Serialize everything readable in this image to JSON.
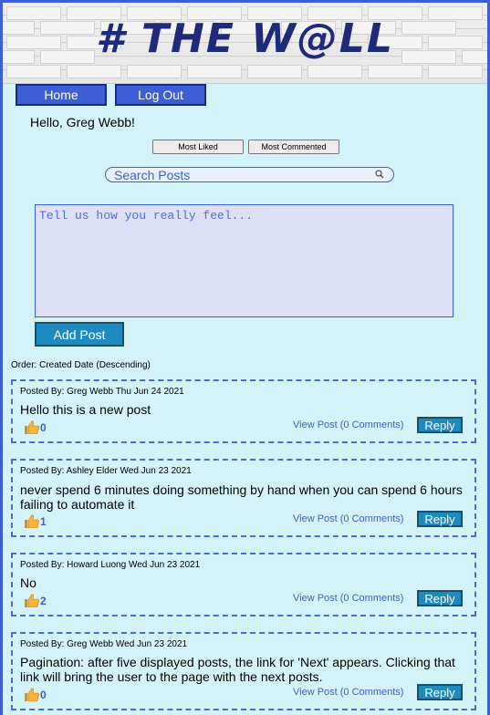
{
  "banner": {
    "logo_text": "# THE W@LL"
  },
  "nav": {
    "home_label": "Home",
    "logout_label": "Log Out"
  },
  "greeting": "Hello, Greg Webb!",
  "sort": {
    "most_liked": "Most Liked",
    "most_commented": "Most Commented"
  },
  "search": {
    "placeholder": "Search Posts"
  },
  "composer": {
    "placeholder": "Tell us how you really feel...",
    "add_label": "Add Post"
  },
  "order_label": "Order: Created Date (Descending)",
  "posts": [
    {
      "meta": "Posted By: Greg Webb Thu Jun 24 2021",
      "body": "Hello this is a new post",
      "likes": "0",
      "view": "View Post (0 Comments)",
      "reply": "Reply"
    },
    {
      "meta": "Posted By: Ashley Elder Wed Jun 23 2021",
      "body": "never spend 6 minutes doing something by hand when you can spend 6 hours failing to automate it",
      "likes": "1",
      "view": "View Post (0 Comments)",
      "reply": "Reply"
    },
    {
      "meta": "Posted By: Howard Luong Wed Jun 23 2021",
      "body": "No",
      "likes": "2",
      "view": "View Post (0 Comments)",
      "reply": "Reply"
    },
    {
      "meta": "Posted By: Greg Webb Wed Jun 23 2021",
      "body": "Pagination: after five displayed posts, the link for 'Next' appears. Clicking that link will bring the user to the page with the next posts.",
      "likes": "0",
      "view": "View Post (0 Comments)",
      "reply": "Reply"
    }
  ],
  "colors": {
    "background": "#d3f3f9",
    "accent": "#3c5fd6",
    "button": "#1d8bbf",
    "logo": "#1f2a7a"
  },
  "icons": {
    "like": "thumbs-up-icon",
    "search": "search-icon"
  }
}
